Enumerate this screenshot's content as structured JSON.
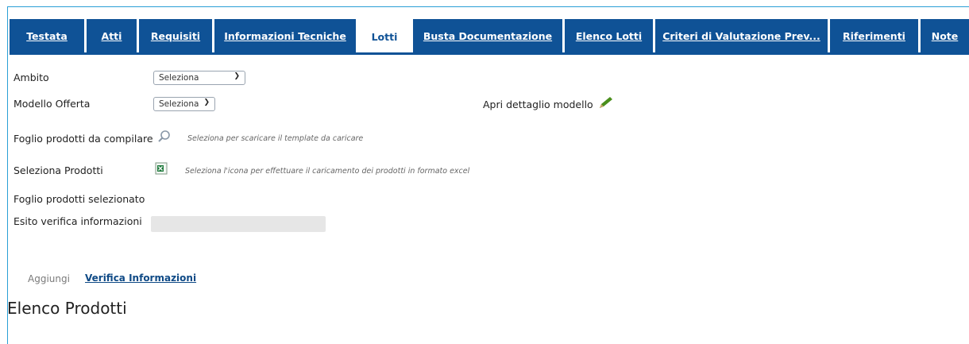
{
  "tabs": [
    {
      "label": "Testata",
      "active": false
    },
    {
      "label": "Atti",
      "active": false
    },
    {
      "label": "Requisiti",
      "active": false
    },
    {
      "label": "Informazioni Tecniche",
      "active": false
    },
    {
      "label": "Lotti",
      "active": true
    },
    {
      "label": "Busta Documentazione",
      "active": false
    },
    {
      "label": "Elenco Lotti",
      "active": false
    },
    {
      "label": "Criteri di Valutazione Prev...",
      "active": false
    },
    {
      "label": "Riferimenti",
      "active": false
    },
    {
      "label": "Note",
      "active": false
    }
  ],
  "form": {
    "ambito_label": "Ambito",
    "ambito_value": "Seleziona",
    "modello_label": "Modello Offerta",
    "modello_value": "Seleziona",
    "apri_dettaglio": "Apri dettaglio modello",
    "foglio_compilare_label": "Foglio prodotti da compilare",
    "foglio_compilare_hint": "Seleziona per scaricare il template da caricare",
    "seleziona_prodotti_label": "Seleziona Prodotti",
    "seleziona_prodotti_hint": "Seleziona l'icona per effettuare il caricamento dei prodotti in formato excel",
    "foglio_selezionato_label": "Foglio prodotti selezionato",
    "esito_label": "Esito verifica informazioni",
    "esito_value": ""
  },
  "actions": {
    "aggiungi": "Aggiungi",
    "verifica": "Verifica Informazioni"
  },
  "section_title": "Elenco Prodotti",
  "colors": {
    "tab_bg": "#0f5296",
    "frame": "#2a9fd6",
    "pencil": "#4a8f1c",
    "excel": "#1e7a3c"
  }
}
